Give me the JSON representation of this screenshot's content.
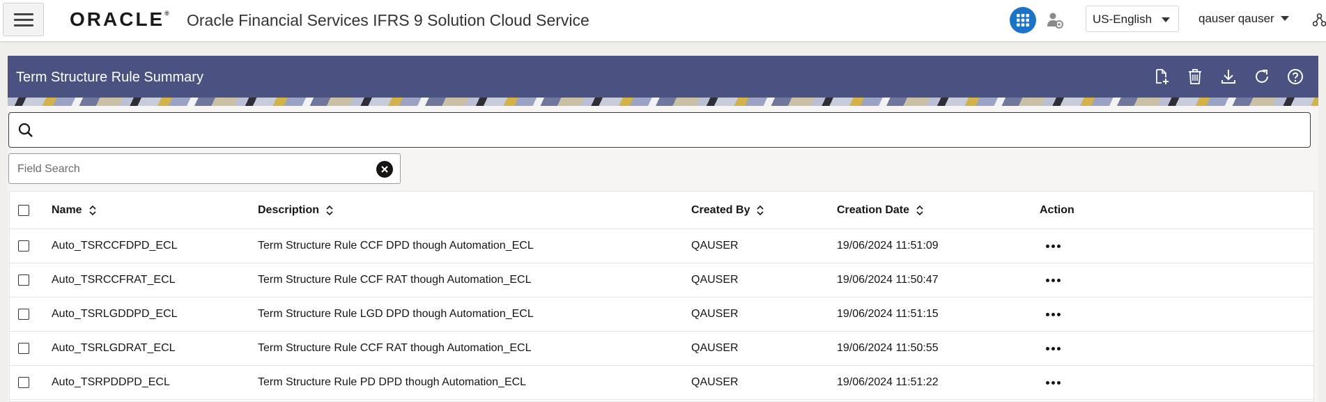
{
  "header": {
    "menu_icon": "hamburger-icon",
    "logo_text": "ORACLE",
    "logo_mark": "®",
    "app_title": "Oracle Financial Services IFRS 9 Solution Cloud Service",
    "apps_icon": "grid-icon",
    "admin_icon": "admin-user-icon",
    "language": "US-English",
    "user": "qauser qauser",
    "org_icon": "hierarchy-icon",
    "accent_color": "#1b74c7"
  },
  "page": {
    "title": "Term Structure Rule Summary",
    "title_bar_color": "#4a5282",
    "toolbar_icons": [
      "add-document-icon",
      "delete-icon",
      "download-icon",
      "refresh-icon",
      "help-icon"
    ],
    "search_icon": "search-icon",
    "field_search_placeholder": "Field Search"
  },
  "table": {
    "columns": {
      "name": "Name",
      "description": "Description",
      "created_by": "Created By",
      "creation_date": "Creation Date",
      "action": "Action"
    },
    "rows": [
      {
        "name": "Auto_TSRCCFDPD_ECL",
        "description": "Term Structure Rule CCF DPD though Automation_ECL",
        "created_by": "QAUSER",
        "creation_date": "19/06/2024 11:51:09"
      },
      {
        "name": "Auto_TSRCCFRAT_ECL",
        "description": "Term Structure Rule CCF RAT though Automation_ECL",
        "created_by": "QAUSER",
        "creation_date": "19/06/2024 11:50:47"
      },
      {
        "name": "Auto_TSRLGDDPD_ECL",
        "description": "Term Structure Rule LGD DPD though Automation_ECL",
        "created_by": "QAUSER",
        "creation_date": "19/06/2024 11:51:15"
      },
      {
        "name": "Auto_TSRLGDRAT_ECL",
        "description": "Term Structure Rule CCF RAT though Automation_ECL",
        "created_by": "QAUSER",
        "creation_date": "19/06/2024 11:50:55"
      },
      {
        "name": "Auto_TSRPDDPD_ECL",
        "description": "Term Structure Rule PD DPD though Automation_ECL",
        "created_by": "QAUSER",
        "creation_date": "19/06/2024 11:51:22"
      }
    ]
  }
}
